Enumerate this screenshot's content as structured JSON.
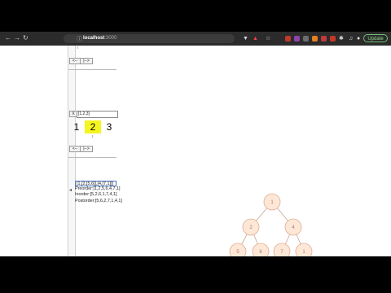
{
  "browser": {
    "url_host": "localhost",
    "url_port": ":3000",
    "update_label": "Update",
    "ext_colors": [
      "#c0392b",
      "#8e44ad",
      "#6d6d6d",
      "#e67e22",
      "#bf3a3a",
      "#c0392b"
    ]
  },
  "top_controls": {
    "btn_a": "<--",
    "btn_b": "|-->"
  },
  "array_row": {
    "clear_btn": "X",
    "input_value": "[1,2,3]"
  },
  "numbers": [
    "1",
    "2",
    "3"
  ],
  "highlighted_index": 1,
  "mid_controls": {
    "btn_a": "<--",
    "btn_b": "|-->"
  },
  "tree_input": {
    "value": "[1,[2,[5,6]],[4,[7,1]]]"
  },
  "traversals": {
    "preorder": "Preorder:[1,2,5,6,4,7,1]",
    "inorder": "Inorder:[5,2,6,1,7,4,1]",
    "postorder": "Postorder:[5,6,2,7,1,4,1]"
  },
  "tree_nodes": [
    "1",
    "2",
    "4",
    "5",
    "6",
    "7",
    "1"
  ],
  "tree_style": {
    "node_fill": "#fde7d7",
    "node_stroke": "#e2ad90",
    "edge_color": "#caa48f"
  }
}
